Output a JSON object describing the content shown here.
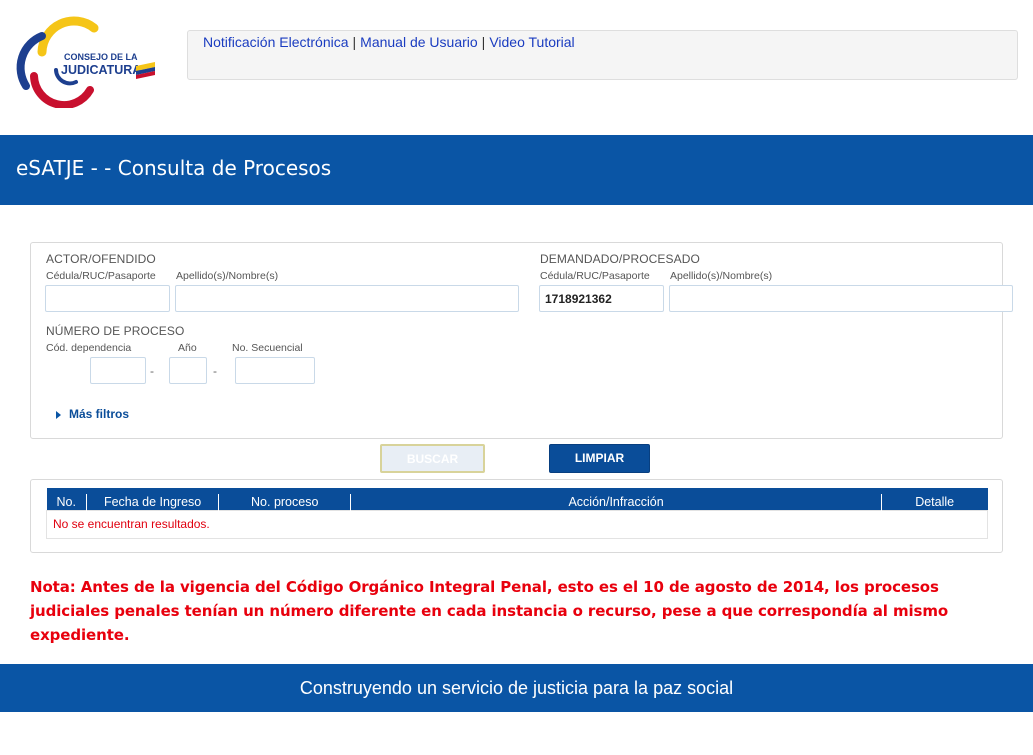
{
  "header": {
    "logo_text_line1": "CONSEJO DE LA",
    "logo_text_line2": "JUDICATURA",
    "links": [
      {
        "label": "Notificación Electrónica"
      },
      {
        "label": "Manual de Usuario"
      },
      {
        "label": "Video Tutorial"
      }
    ],
    "separator": "|"
  },
  "title_bar": {
    "title": "eSATJE - - Consulta de Procesos"
  },
  "search": {
    "actor": {
      "section_title": "ACTOR/OFENDIDO",
      "id_label": "Cédula/RUC/Pasaporte",
      "id_value": "",
      "name_label": "Apellido(s)/Nombre(s)",
      "name_value": ""
    },
    "demandado": {
      "section_title": "DEMANDADO/PROCESADO",
      "id_label": "Cédula/RUC/Pasaporte",
      "id_value": "1718921362",
      "name_label": "Apellido(s)/Nombre(s)",
      "name_value": ""
    },
    "numero_proceso": {
      "section_title": "NÚMERO DE PROCESO",
      "dependencia_label": "Cód. dependencia",
      "anio_label": "Año",
      "secuencial_label": "No. Secuencial",
      "dash": "-"
    },
    "more_filters": "Más filtros"
  },
  "buttons": {
    "search": "BUSCAR",
    "clear": "LIMPIAR"
  },
  "results": {
    "columns": [
      "No.",
      "Fecha de Ingreso",
      "No. proceso",
      "Acción/Infracción",
      "Detalle"
    ],
    "empty_message": "No se encuentran resultados."
  },
  "note": "Nota: Antes de la vigencia del Código Orgánico Integral Penal, esto es el 10 de agosto de 2014, los procesos judiciales penales tenían un número diferente en cada instancia o recurso, pese a que correspondía al mismo expediente.",
  "footer": {
    "slogan": "Construyendo un servicio de justicia para la paz social"
  },
  "colors": {
    "brand_blue": "#0a55a5",
    "button_blue": "#0a4d99",
    "link_blue": "#1a3cc0",
    "note_red": "#e8000d",
    "logo_yellow": "#f5c518",
    "logo_red": "#c8102e",
    "logo_navy": "#1d3f8f"
  }
}
